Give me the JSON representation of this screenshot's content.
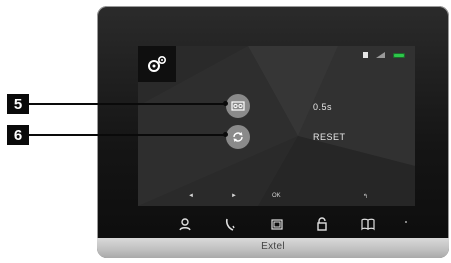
{
  "brand": "Extel",
  "screen": {
    "settings_icon": "gears-icon",
    "status_icons": [
      "document-icon",
      "signal-icon",
      "battery-icon"
    ],
    "rows": [
      {
        "callout": "5",
        "icon": "tape-icon",
        "value": "0.5s"
      },
      {
        "callout": "6",
        "icon": "reset-arrows-icon",
        "value": "RESET"
      }
    ],
    "softkeys": {
      "left": "◄",
      "right": "►",
      "ok": "OK",
      "back": "↰"
    }
  },
  "bottom_bar": {
    "icons": [
      "user-icon",
      "handset-icon",
      "camera-icon",
      "unlock-icon",
      "book-icon"
    ]
  },
  "colors": {
    "battery": "#2ec74b",
    "screen": "#2b2b2b",
    "callout": "#0a0a0a"
  }
}
